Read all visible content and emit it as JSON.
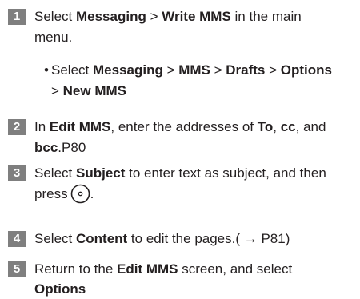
{
  "steps": [
    {
      "num": "1",
      "t1": "Select ",
      "b1": "Messaging",
      "t2": " > ",
      "b2": "Write MMS",
      "t3": " in the main",
      "line2": "menu."
    },
    {
      "bullet": "•",
      "t1": "Select ",
      "b1": "Messaging",
      "t2": " > ",
      "b2": "MMS",
      "t3": " > ",
      "b3": "Drafts",
      "t4": " > ",
      "b4": "Options",
      "l2_t1": "> ",
      "l2_b1": "New MMS"
    },
    {
      "num": "2",
      "t1": "In ",
      "b1": "Edit MMS",
      "t2": ", enter the addresses of ",
      "b2": "To",
      "t3": ", ",
      "b3": "cc",
      "t4": ", and",
      "l2_b1": "bcc",
      "l2_t1": ".P80"
    },
    {
      "num": "3",
      "t1": "Select ",
      "b1": "Subject",
      "t2": " to enter text as subject, and then",
      "l2_t1": "press",
      "l2_t2": "."
    },
    {
      "num": "4",
      "t1": "Select ",
      "b1": "Content",
      "t2": " to edit the pages.( → P81)"
    },
    {
      "num": "5",
      "t1": "Return to the ",
      "b1": "Edit MMS",
      "t2": " screen, and select",
      "l2_b1": "Options"
    }
  ]
}
